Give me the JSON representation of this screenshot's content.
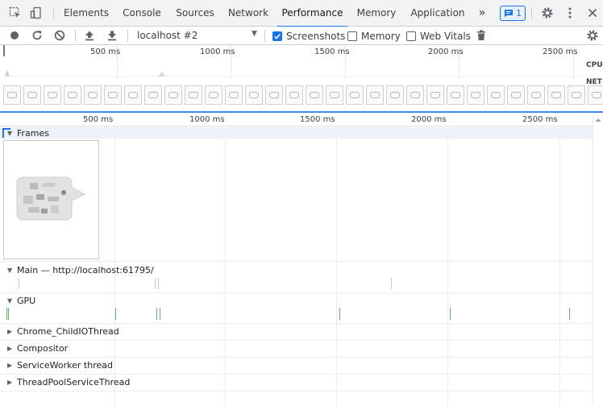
{
  "tabs": [
    {
      "label": "Elements"
    },
    {
      "label": "Console"
    },
    {
      "label": "Sources"
    },
    {
      "label": "Network"
    },
    {
      "label": "Performance",
      "active": true
    },
    {
      "label": "Memory"
    },
    {
      "label": "Application"
    }
  ],
  "tabbar": {
    "overflow_label": "»",
    "issues_count": "1",
    "icons": [
      "inspect-icon",
      "device-toolbar-icon",
      "issues-icon",
      "settings-icon",
      "more-icon",
      "close-icon"
    ]
  },
  "toolbar": {
    "target": "localhost #2",
    "screenshots_label": "Screenshots",
    "screenshots_checked": true,
    "memory_label": "Memory",
    "memory_checked": false,
    "webvitals_label": "Web Vitals",
    "webvitals_checked": false,
    "icons": [
      "record-icon",
      "reload-icon",
      "clear-icon",
      "upload-icon",
      "download-icon",
      "garbage-collect-icon",
      "capture-settings-icon"
    ]
  },
  "overview": {
    "ticks": [
      "500 ms",
      "1000 ms",
      "1500 ms",
      "2000 ms",
      "2500 ms"
    ],
    "cpu_label": "CPU",
    "net_label": "NET",
    "screenshot_count": 30
  },
  "flamechart": {
    "ticks": [
      "500 ms",
      "1000 ms",
      "1500 ms",
      "2000 ms",
      "2500 ms"
    ],
    "tracks": [
      {
        "name": "Frames",
        "expanded": true
      },
      {
        "name": "Main — http://localhost:61795/",
        "expanded": true
      },
      {
        "name": "GPU",
        "expanded": true
      },
      {
        "name": "Chrome_ChildIOThread",
        "expanded": false
      },
      {
        "name": "Compositor",
        "expanded": false
      },
      {
        "name": "ServiceWorker thread",
        "expanded": false
      },
      {
        "name": "ThreadPoolServiceThread",
        "expanded": false
      }
    ]
  },
  "colors": {
    "accent": "#1a73e8",
    "gpu_mark": "#5dbb63"
  }
}
